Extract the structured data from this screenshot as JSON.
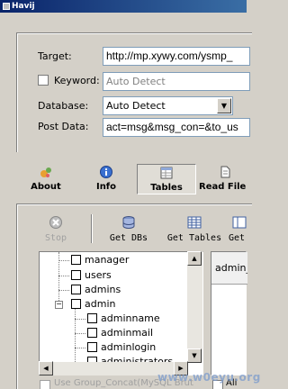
{
  "window": {
    "title": "Havij"
  },
  "form": {
    "target_label": "Target:",
    "target_value": "http://mp.xywy.com/ysmp_",
    "keyword_label": "Keyword:",
    "keyword_placeholder": "Auto Detect",
    "database_label": "Database:",
    "database_value": "Auto Detect",
    "postdata_label": "Post Data:",
    "postdata_value": "act=msg&msg_con=&to_us"
  },
  "nav": [
    {
      "label": "About",
      "icon": "about-icon"
    },
    {
      "label": "Info",
      "icon": "info-icon"
    },
    {
      "label": "Tables",
      "icon": "tables-icon",
      "active": true
    },
    {
      "label": "Read File",
      "icon": "read-file-icon"
    }
  ],
  "toolbar": {
    "stop_label": "Stop",
    "get_dbs_label": "Get DBs",
    "get_tables_label": "Get Tables",
    "get_columns_label": "Get"
  },
  "tree": {
    "items": [
      "manager",
      "users",
      "admins",
      "admin",
      "adminname",
      "adminmail",
      "adminlogin",
      "administrators"
    ]
  },
  "right_pane": {
    "header": "admin_"
  },
  "bottom": {
    "use_group_label": "Use Group_Concat(MySQL Brut",
    "all_label": "All"
  },
  "watermark": "www.w0eyu.org",
  "colors": {
    "titlebar": "#0a246a",
    "face": "#d4d0c8",
    "field_border": "#7f9db9"
  }
}
